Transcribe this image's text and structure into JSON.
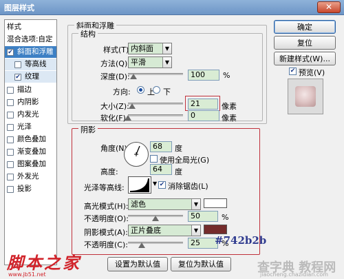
{
  "dialog": {
    "title": "图层样式",
    "close_symbol": "✕"
  },
  "style_list": {
    "items": [
      {
        "label": "样式",
        "checkbox": false,
        "checked": false,
        "state": "header"
      },
      {
        "label": "混合选项:自定",
        "checkbox": false,
        "checked": false,
        "state": "normal"
      },
      {
        "label": "斜面和浮雕",
        "checkbox": true,
        "checked": true,
        "state": "selected"
      },
      {
        "label": "等高线",
        "checkbox": true,
        "checked": false,
        "state": "sub"
      },
      {
        "label": "纹理",
        "checkbox": true,
        "checked": true,
        "state": "sub"
      },
      {
        "label": "描边",
        "checkbox": true,
        "checked": false,
        "state": "normal"
      },
      {
        "label": "内阴影",
        "checkbox": true,
        "checked": false,
        "state": "normal"
      },
      {
        "label": "内发光",
        "checkbox": true,
        "checked": false,
        "state": "normal"
      },
      {
        "label": "光泽",
        "checkbox": true,
        "checked": false,
        "state": "normal"
      },
      {
        "label": "颜色叠加",
        "checkbox": true,
        "checked": false,
        "state": "normal"
      },
      {
        "label": "渐变叠加",
        "checkbox": true,
        "checked": false,
        "state": "normal"
      },
      {
        "label": "图案叠加",
        "checkbox": true,
        "checked": false,
        "state": "normal"
      },
      {
        "label": "外发光",
        "checkbox": true,
        "checked": false,
        "state": "normal"
      },
      {
        "label": "投影",
        "checkbox": true,
        "checked": false,
        "state": "normal"
      }
    ]
  },
  "bevel": {
    "section_title": "斜面和浮雕",
    "structure_title": "结构",
    "style_label": "样式(T):",
    "style_value": "内斜面",
    "technique_label": "方法(Q):",
    "technique_value": "平滑",
    "depth_label": "深度(D):",
    "depth_value": "100",
    "depth_unit": "%",
    "depth_fraction": 0.1,
    "direction_label": "方向:",
    "direction_up": "上",
    "direction_down": "下",
    "direction_selected": "上",
    "size_label": "大小(Z):",
    "size_value": "21",
    "size_unit": "像素",
    "size_fraction": 0.08,
    "soften_label": "软化(F):",
    "soften_value": "0",
    "soften_unit": "像素",
    "soften_fraction": 0.0
  },
  "shading": {
    "title": "阴影",
    "angle_label": "角度(N):",
    "angle_value": "68",
    "angle_unit": "度",
    "use_global_light_label": "使用全局光(G)",
    "use_global_light_checked": false,
    "altitude_label": "高度:",
    "altitude_value": "64",
    "altitude_unit": "度",
    "gloss_contour_label": "光泽等高线:",
    "anti_aliased_label": "消除锯齿(L)",
    "anti_aliased_checked": true,
    "highlight_mode_label": "高光模式(H):",
    "highlight_mode_value": "滤色",
    "highlight_color": "#ffffff",
    "highlight_opacity_label": "不透明度(O):",
    "highlight_opacity_value": "50",
    "highlight_opacity_fraction": 0.5,
    "shadow_mode_label": "阴影模式(A):",
    "shadow_mode_value": "正片叠底",
    "shadow_color": "#742b2b",
    "shadow_opacity_label": "不透明度(C):",
    "shadow_opacity_value": "25",
    "shadow_opacity_fraction": 0.25,
    "percent": "%"
  },
  "footer": {
    "make_default": "设置为默认值",
    "reset_default": "复位为默认值"
  },
  "buttons": {
    "ok": "确定",
    "reset": "复位",
    "new_style": "新建样式(W)...",
    "preview_label": "预览(V)",
    "preview_checked": true
  },
  "annotations": {
    "hex_note": "#742b2b"
  },
  "watermarks": {
    "left": "脚本之家",
    "left_sub": "www.jb51.net",
    "right": "查字典 教程网",
    "right_sub": "jiaocheng.chazidian.com"
  },
  "colors": {
    "selected_row": "#3d80c4",
    "field_bg": "#d9ecd4",
    "highlight_box": "#c0303a"
  }
}
